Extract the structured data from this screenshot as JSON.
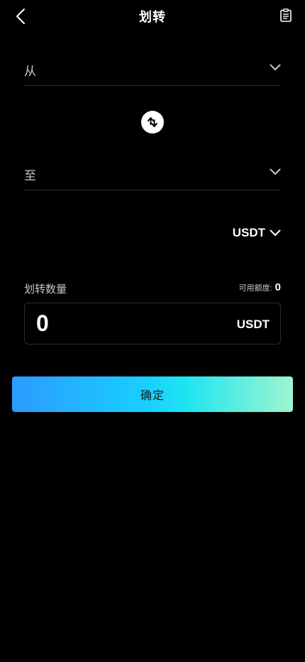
{
  "header": {
    "title": "划转",
    "back_icon": "chevron-left-icon",
    "record_icon": "clipboard-icon"
  },
  "transfer": {
    "from_label": "从",
    "to_label": "至",
    "swap_icon": "swap-arrows-icon"
  },
  "currency": {
    "selected": "USDT"
  },
  "amount": {
    "label": "划转数量",
    "available_label": "可用额度:",
    "available_value": "0",
    "value": "0",
    "unit": "USDT"
  },
  "confirm": {
    "label": "确定"
  },
  "colors": {
    "background": "#000000",
    "text_primary": "#ffffff",
    "text_secondary": "#c8c8c8",
    "divider": "#2a2a2a",
    "button_gradient_start": "#2b9bff",
    "button_gradient_mid": "#19cfff",
    "button_gradient_end": "#9ef5cf"
  }
}
